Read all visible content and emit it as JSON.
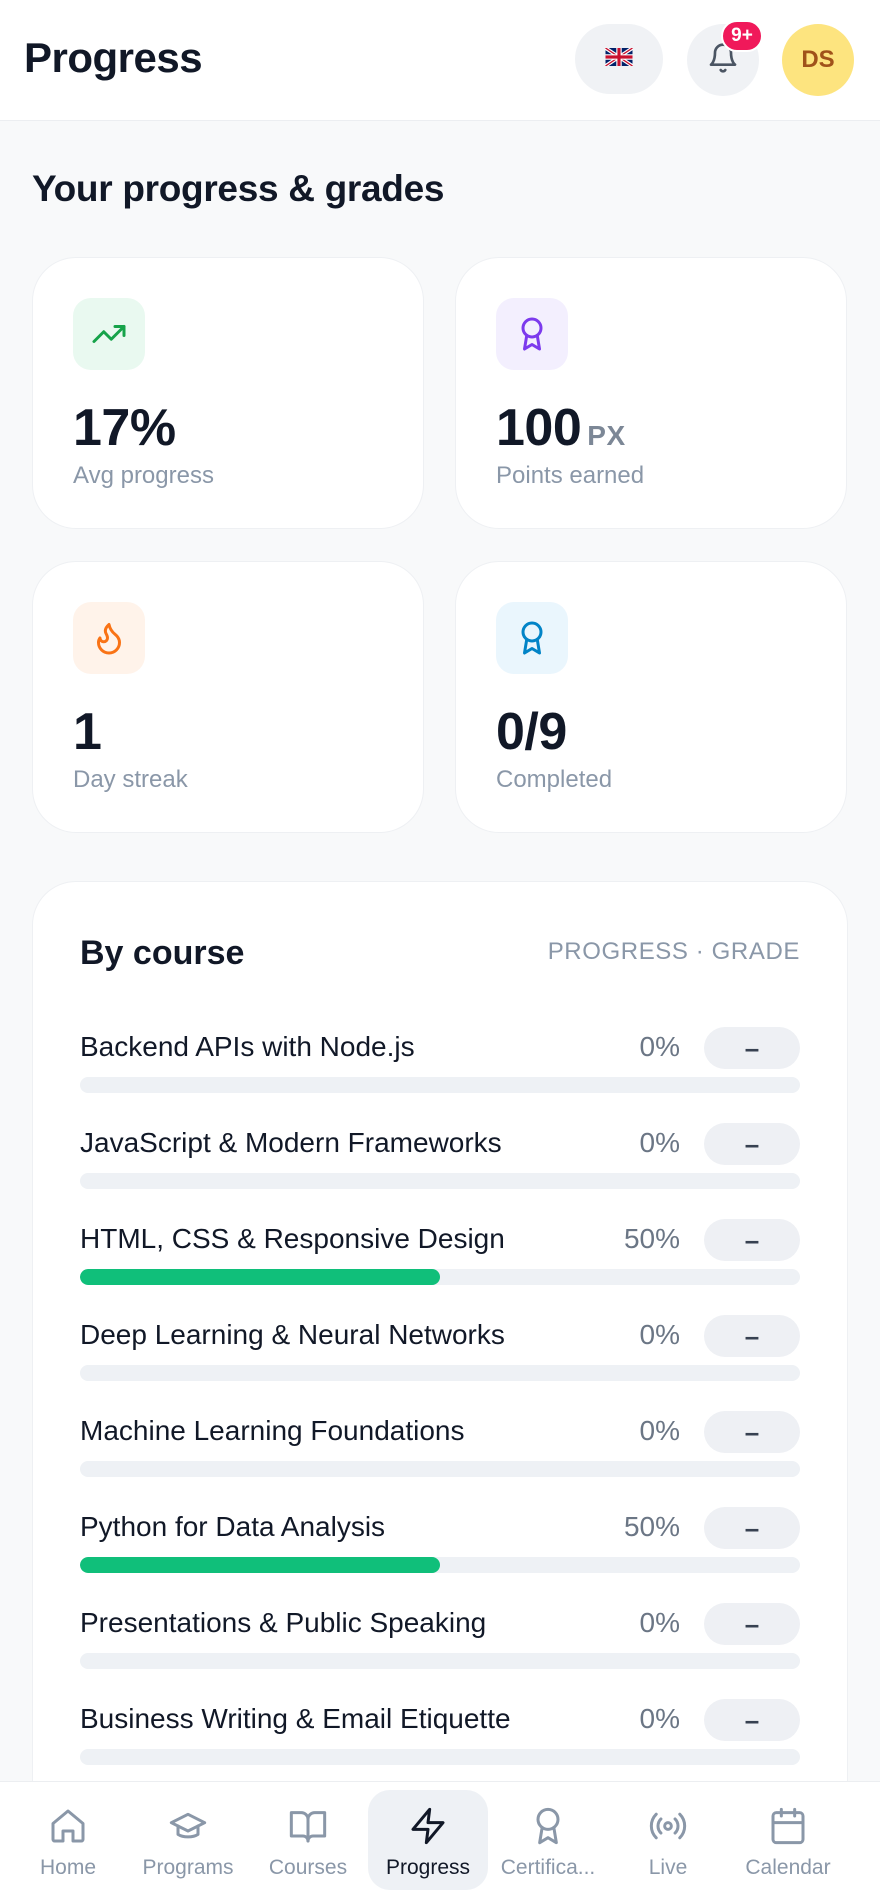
{
  "header": {
    "title": "Progress",
    "notification_count": "9+",
    "avatar_initials": "DS"
  },
  "section_title": "Your progress & grades",
  "stats": [
    {
      "value": "17%",
      "unit": "",
      "label": "Avg progress",
      "icon": "trending-up-icon",
      "icon_color": "#16a34a",
      "icon_bg": "#e9f9f0"
    },
    {
      "value": "100",
      "unit": "PX",
      "label": "Points earned",
      "icon": "award-icon",
      "icon_color": "#7c3aed",
      "icon_bg": "#f3effe"
    },
    {
      "value": "1",
      "unit": "",
      "label": "Day streak",
      "icon": "flame-icon",
      "icon_color": "#f97316",
      "icon_bg": "#fff3ea"
    },
    {
      "value": "0/9",
      "unit": "",
      "label": "Completed",
      "icon": "badge-icon",
      "icon_color": "#0284c7",
      "icon_bg": "#eaf6fd"
    }
  ],
  "courses_section": {
    "title": "By course",
    "hint": "PROGRESS · GRADE",
    "courses": [
      {
        "name": "Backend APIs with Node.js",
        "progress": "0%",
        "progress_value": 0,
        "grade": "–"
      },
      {
        "name": "JavaScript & Modern Frameworks",
        "progress": "0%",
        "progress_value": 0,
        "grade": "–"
      },
      {
        "name": "HTML, CSS & Responsive Design",
        "progress": "50%",
        "progress_value": 50,
        "grade": "–"
      },
      {
        "name": "Deep Learning & Neural Networks",
        "progress": "0%",
        "progress_value": 0,
        "grade": "–"
      },
      {
        "name": "Machine Learning Foundations",
        "progress": "0%",
        "progress_value": 0,
        "grade": "–"
      },
      {
        "name": "Python for Data Analysis",
        "progress": "50%",
        "progress_value": 50,
        "grade": "–"
      },
      {
        "name": "Presentations & Public Speaking",
        "progress": "0%",
        "progress_value": 0,
        "grade": "–"
      },
      {
        "name": "Business Writing & Email Etiquette",
        "progress": "0%",
        "progress_value": 0,
        "grade": "–"
      }
    ]
  },
  "bottom_nav": {
    "items": [
      {
        "label": "Home",
        "icon": "home-icon",
        "active": false
      },
      {
        "label": "Programs",
        "icon": "graduation-cap-icon",
        "active": false
      },
      {
        "label": "Courses",
        "icon": "book-open-icon",
        "active": false
      },
      {
        "label": "Progress",
        "icon": "zap-icon",
        "active": true
      },
      {
        "label": "Certifica...",
        "icon": "certificate-icon",
        "active": false
      },
      {
        "label": "Live",
        "icon": "broadcast-icon",
        "active": false
      },
      {
        "label": "Calendar",
        "icon": "calendar-icon",
        "active": false
      }
    ]
  },
  "colors": {
    "progress_fill": "#10bf7a",
    "badge": "#f0195a",
    "avatar_bg": "#fde47f"
  }
}
